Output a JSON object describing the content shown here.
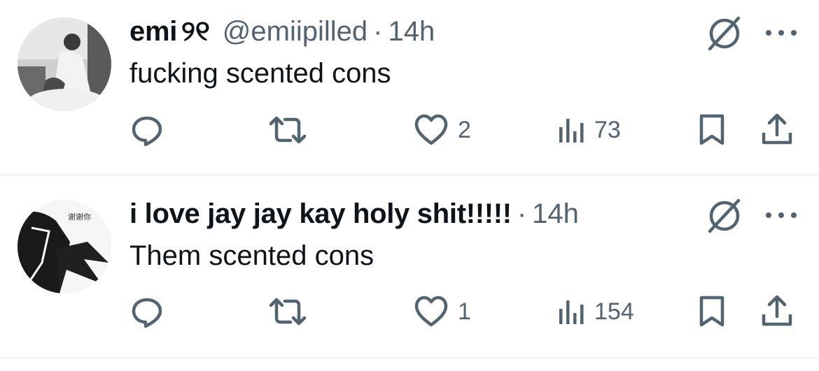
{
  "tweets": [
    {
      "name": "emi",
      "emoji": "୨୧",
      "handle": "@emiipilled",
      "separator": "·",
      "time": "14h",
      "text": "fucking scented cons",
      "replies": "",
      "reposts": "",
      "likes": "2",
      "views": "73"
    },
    {
      "name": "i love jay jay kay holy shit!!!!!",
      "emoji": "",
      "handle": "",
      "separator": "·",
      "time": "14h",
      "text": "Them scented cons",
      "avatar_text": "谢谢你",
      "replies": "",
      "reposts": "",
      "likes": "1",
      "views": "154"
    }
  ],
  "icons": {
    "reply": "reply-icon",
    "repost": "repost-icon",
    "like": "heart-icon",
    "views": "views-icon",
    "bookmark": "bookmark-icon",
    "share": "share-icon",
    "grok": "grok-icon",
    "more": "more-icon"
  },
  "colors": {
    "text": "#0f1419",
    "secondary": "#536471",
    "divider": "#eff3f4"
  }
}
